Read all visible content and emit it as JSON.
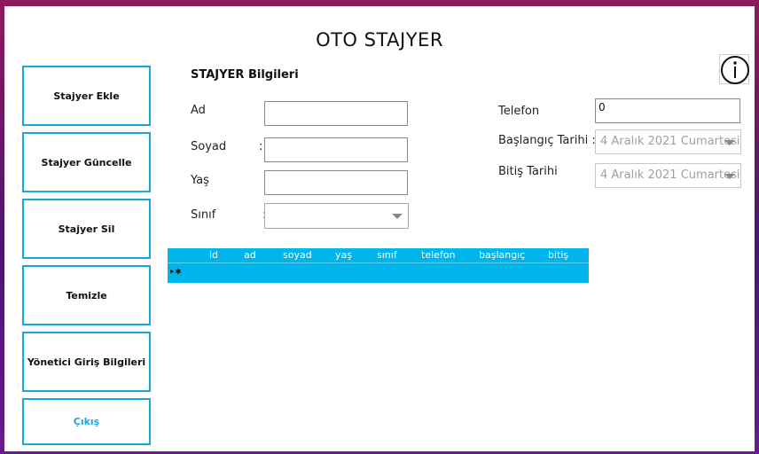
{
  "app": {
    "title": "OTO STAJYER"
  },
  "sidebar": {
    "buttons": [
      {
        "label": "Stajyer Ekle"
      },
      {
        "label": "Stajyer Güncelle"
      },
      {
        "label": "Stajyer Sil"
      },
      {
        "label": "Temizle"
      },
      {
        "label": "Yönetici Giriş Bilgileri"
      },
      {
        "label": "Çıkış"
      }
    ]
  },
  "form": {
    "section_title": "STAJYER Bilgileri",
    "ad": {
      "label": "Ad",
      "value": ""
    },
    "soyad": {
      "label": "Soyad",
      "value": ""
    },
    "yas": {
      "label": "Yaş",
      "value": ""
    },
    "sinif": {
      "label": "Sınıf",
      "value": ""
    },
    "telefon": {
      "label": "Telefon",
      "value": "0"
    },
    "baslangic": {
      "label": "Başlangıç Tarihi :",
      "value": "4 Aralık 2021 Cumartesi"
    },
    "bitis": {
      "label": "Bitiş Tarihi",
      "value": "4 Aralık 2021 Cumartesi"
    },
    "colon": ":"
  },
  "grid": {
    "columns": [
      "id",
      "ad",
      "soyad",
      "yaş",
      "sınıf",
      "telefon",
      "başlangıç",
      "bitiş"
    ],
    "new_row_marker": "▸✱"
  },
  "colors": {
    "accent": "#19a7dd",
    "grid": "#00b4ec"
  },
  "icons": {
    "info": "info-icon"
  }
}
